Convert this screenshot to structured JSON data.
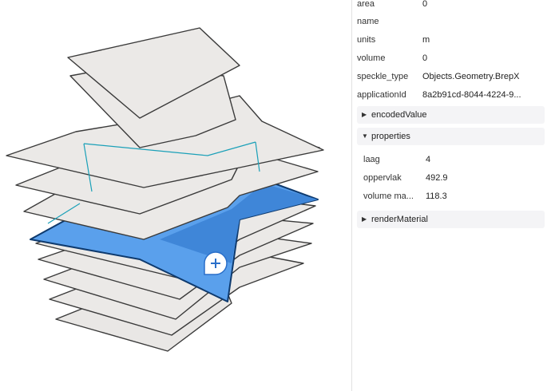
{
  "properties_panel": {
    "attributes": [
      {
        "key": "area",
        "value": "0"
      },
      {
        "key": "name",
        "value": ""
      },
      {
        "key": "units",
        "value": "m"
      },
      {
        "key": "volume",
        "value": "0"
      },
      {
        "key": "speckle_type",
        "value": "Objects.Geometry.BrepX"
      },
      {
        "key": "applicationId",
        "value": "8a2b91cd-8044-4224-9..."
      }
    ],
    "sections": {
      "encoded_value": {
        "title": "encodedValue",
        "expanded": false
      },
      "properties": {
        "title": "properties",
        "expanded": true,
        "items": [
          {
            "key": "laag",
            "value": "4"
          },
          {
            "key": "oppervlak",
            "value": "492.9"
          },
          {
            "key": "volume ma...",
            "value": "118.3"
          }
        ]
      },
      "render_material": {
        "title": "renderMaterial",
        "expanded": false
      }
    }
  },
  "viewer": {
    "cursor_icon": "plus-icon",
    "colors": {
      "slab_fill": "#ebe9e7",
      "slab_edge": "#3a3a3a",
      "selected_fill": "#5aa0ec",
      "selected_edge": "#0e3a6e",
      "outline_accent": "#1aa0b8"
    }
  }
}
